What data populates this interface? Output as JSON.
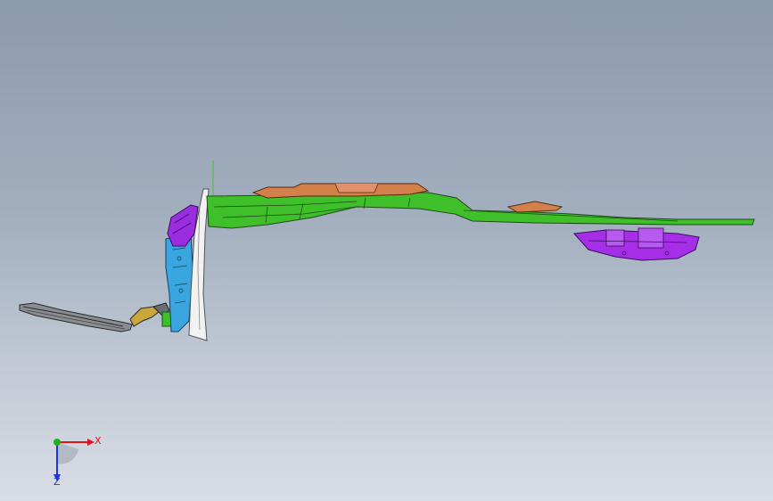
{
  "viewport": {
    "background_top": "#8c9aad",
    "background_bottom": "#d9dee5"
  },
  "model": {
    "parts": [
      {
        "name": "roof-panel-green",
        "color": "#3fbf2a"
      },
      {
        "name": "sunroof-frame-orange",
        "color": "#d4804a"
      },
      {
        "name": "pillar-reinforcement-blue",
        "color": "#3aa6e0"
      },
      {
        "name": "pillar-bracket-purple",
        "color": "#9a2de0"
      },
      {
        "name": "rear-panel-purple",
        "color": "#a52ee6"
      },
      {
        "name": "pillar-trim-white",
        "color": "#f2f2f2"
      },
      {
        "name": "front-rail-gray",
        "color": "#555555"
      }
    ]
  },
  "triad": {
    "x_label": "X",
    "z_label": "Z",
    "x_color": "#e0141a",
    "y_color": "#22b022",
    "z_color": "#2236d8"
  }
}
